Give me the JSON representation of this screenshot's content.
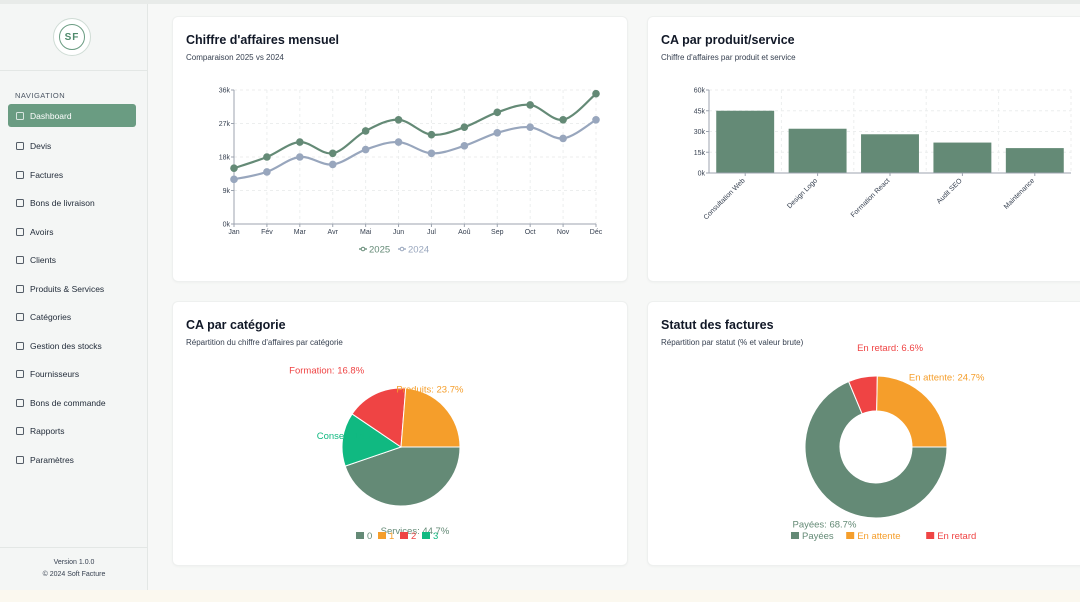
{
  "app": {
    "logo_text": "SF"
  },
  "sidebar": {
    "nav_title": "NAVIGATION",
    "items": [
      {
        "label": "Dashboard",
        "icon": "dashboard-icon",
        "active": true
      },
      {
        "label": "Devis",
        "icon": "clipboard-icon"
      },
      {
        "label": "Factures",
        "icon": "document-icon"
      },
      {
        "label": "Bons de livraison",
        "icon": "truck-icon"
      },
      {
        "label": "Avoirs",
        "icon": "receipt-icon"
      },
      {
        "label": "Clients",
        "icon": "users-icon"
      },
      {
        "label": "Produits & Services",
        "icon": "package-icon"
      },
      {
        "label": "Catégories",
        "icon": "folders-icon"
      },
      {
        "label": "Gestion des stocks",
        "icon": "warehouse-icon"
      },
      {
        "label": "Fournisseurs",
        "icon": "building-icon"
      },
      {
        "label": "Bons de commande",
        "icon": "order-icon"
      },
      {
        "label": "Rapports",
        "icon": "bar-chart-icon"
      },
      {
        "label": "Paramètres",
        "icon": "settings-icon"
      }
    ],
    "version": "Version 1.0.0",
    "copyright": "© 2024 Soft Facture"
  },
  "colors": {
    "primary": "#648a76",
    "secondary": "#98a6bd",
    "orange": "#f59e2b",
    "red": "#ef4444",
    "green": "#10b981"
  },
  "cards": {
    "monthly": {
      "title": "Chiffre d'affaires mensuel",
      "subtitle": "Comparaison 2025 vs 2024"
    },
    "product": {
      "title": "CA par produit/service",
      "subtitle": "Chiffre d'affaires par produit et service"
    },
    "category": {
      "title": "CA par catégorie",
      "subtitle": "Répartition du chiffre d'affaires par catégorie"
    },
    "status": {
      "title": "Statut des factures",
      "subtitle": "Répartition par statut (% et valeur brute)"
    }
  },
  "chart_data": [
    {
      "type": "line",
      "categories": [
        "Jan",
        "Fév",
        "Mar",
        "Avr",
        "Mai",
        "Jun",
        "Jul",
        "Aoû",
        "Sep",
        "Oct",
        "Nov",
        "Déc"
      ],
      "yticks": [
        "0k",
        "9k",
        "18k",
        "27k",
        "36k"
      ],
      "ylim": [
        0,
        36000
      ],
      "series": [
        {
          "name": "2025",
          "values": [
            15000,
            18000,
            22000,
            19000,
            25000,
            28000,
            24000,
            26000,
            30000,
            32000,
            28000,
            35000
          ]
        },
        {
          "name": "2024",
          "values": [
            12000,
            14000,
            18000,
            16000,
            20000,
            22000,
            19000,
            21000,
            24500,
            26000,
            23000,
            28000
          ]
        }
      ],
      "legend": "bottom",
      "grid": true
    },
    {
      "type": "bar",
      "categories": [
        "Consultation Web",
        "Design Logo",
        "Formation React",
        "Audit SEO",
        "Maintenance"
      ],
      "values": [
        45000,
        32000,
        28000,
        22000,
        18000
      ],
      "yticks": [
        "0k",
        "15k",
        "30k",
        "45k",
        "60k"
      ],
      "ylim": [
        0,
        60000
      ],
      "grid": true
    },
    {
      "type": "pie",
      "slices": [
        {
          "label": "Services: 44.7%",
          "value": 44.7,
          "legend": "0"
        },
        {
          "label": "Conseil: 14.7%",
          "value": 14.7,
          "legend": "3"
        },
        {
          "label": "Formation: 16.8%",
          "value": 16.8,
          "legend": "2"
        },
        {
          "label": "Produits: 23.7%",
          "value": 23.7,
          "legend": "1"
        }
      ],
      "legend": [
        "0",
        "1",
        "2",
        "3"
      ]
    },
    {
      "type": "pie",
      "donut": true,
      "slices": [
        {
          "label": "Payées: 68.7%",
          "value": 68.7
        },
        {
          "label": "En retard: 6.6%",
          "value": 6.6
        },
        {
          "label": "En attente: 24.7%",
          "value": 24.7
        }
      ],
      "legend": [
        "Payées",
        "En attente",
        "En retard"
      ]
    }
  ]
}
